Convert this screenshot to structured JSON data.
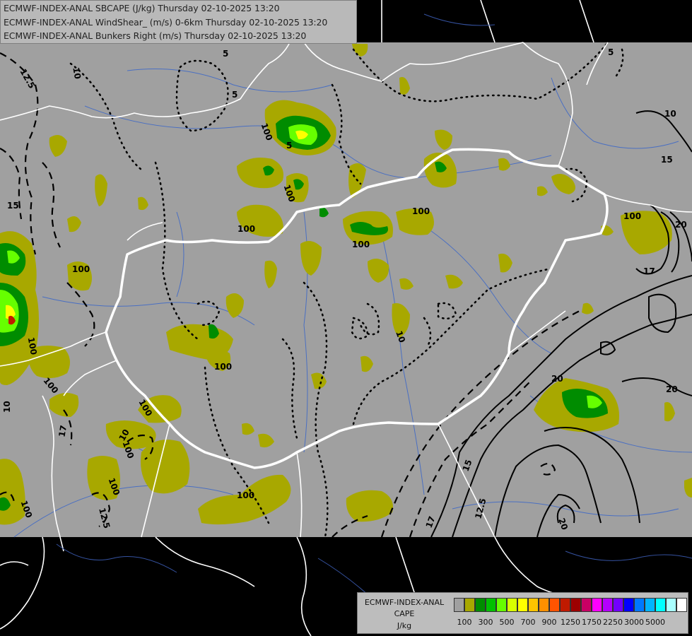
{
  "header": {
    "lines": [
      "ECMWF-INDEX-ANAL SBCAPE (J/kg) Thursday 02-10-2025 13:20",
      "ECMWF-INDEX-ANAL WindShear_ (m/s) 0-6km Thursday 02-10-2025 13:20",
      "ECMWF-INDEX-ANAL Bunkers Right (m/s) Thursday 02-10-2025 13:20"
    ]
  },
  "legend": {
    "title_lines": [
      "ECMWF-INDEX-ANAL",
      "CAPE",
      "J/kg"
    ],
    "colors": [
      "#a0a0a0",
      "#a8a800",
      "#008c00",
      "#00c000",
      "#66ff00",
      "#d8ff00",
      "#ffff00",
      "#ffc400",
      "#ff9000",
      "#ff5400",
      "#c01a00",
      "#9c0000",
      "#c80064",
      "#ff00ff",
      "#b400ff",
      "#7200ff",
      "#0000ff",
      "#0078ff",
      "#00b4ff",
      "#00ffff",
      "#aaffff",
      "#ffffff"
    ],
    "tick_labels": [
      "100",
      "300",
      "500",
      "700",
      "900",
      "1250",
      "1750",
      "2250",
      "3000",
      "5000"
    ]
  },
  "contour_labels": {
    "windshear": [
      "10",
      "12.5",
      "15",
      "17",
      "20"
    ],
    "bunkers": [
      "5",
      "10"
    ],
    "cape": [
      "100"
    ]
  },
  "colors": {
    "background": "#000000",
    "land_mask": "#a0a0a0",
    "cape_low": "#a8a800",
    "cape_mid": "#008c00",
    "cape_high": "#00c000",
    "border": "#ffffff",
    "river": "#4a6fc2"
  }
}
